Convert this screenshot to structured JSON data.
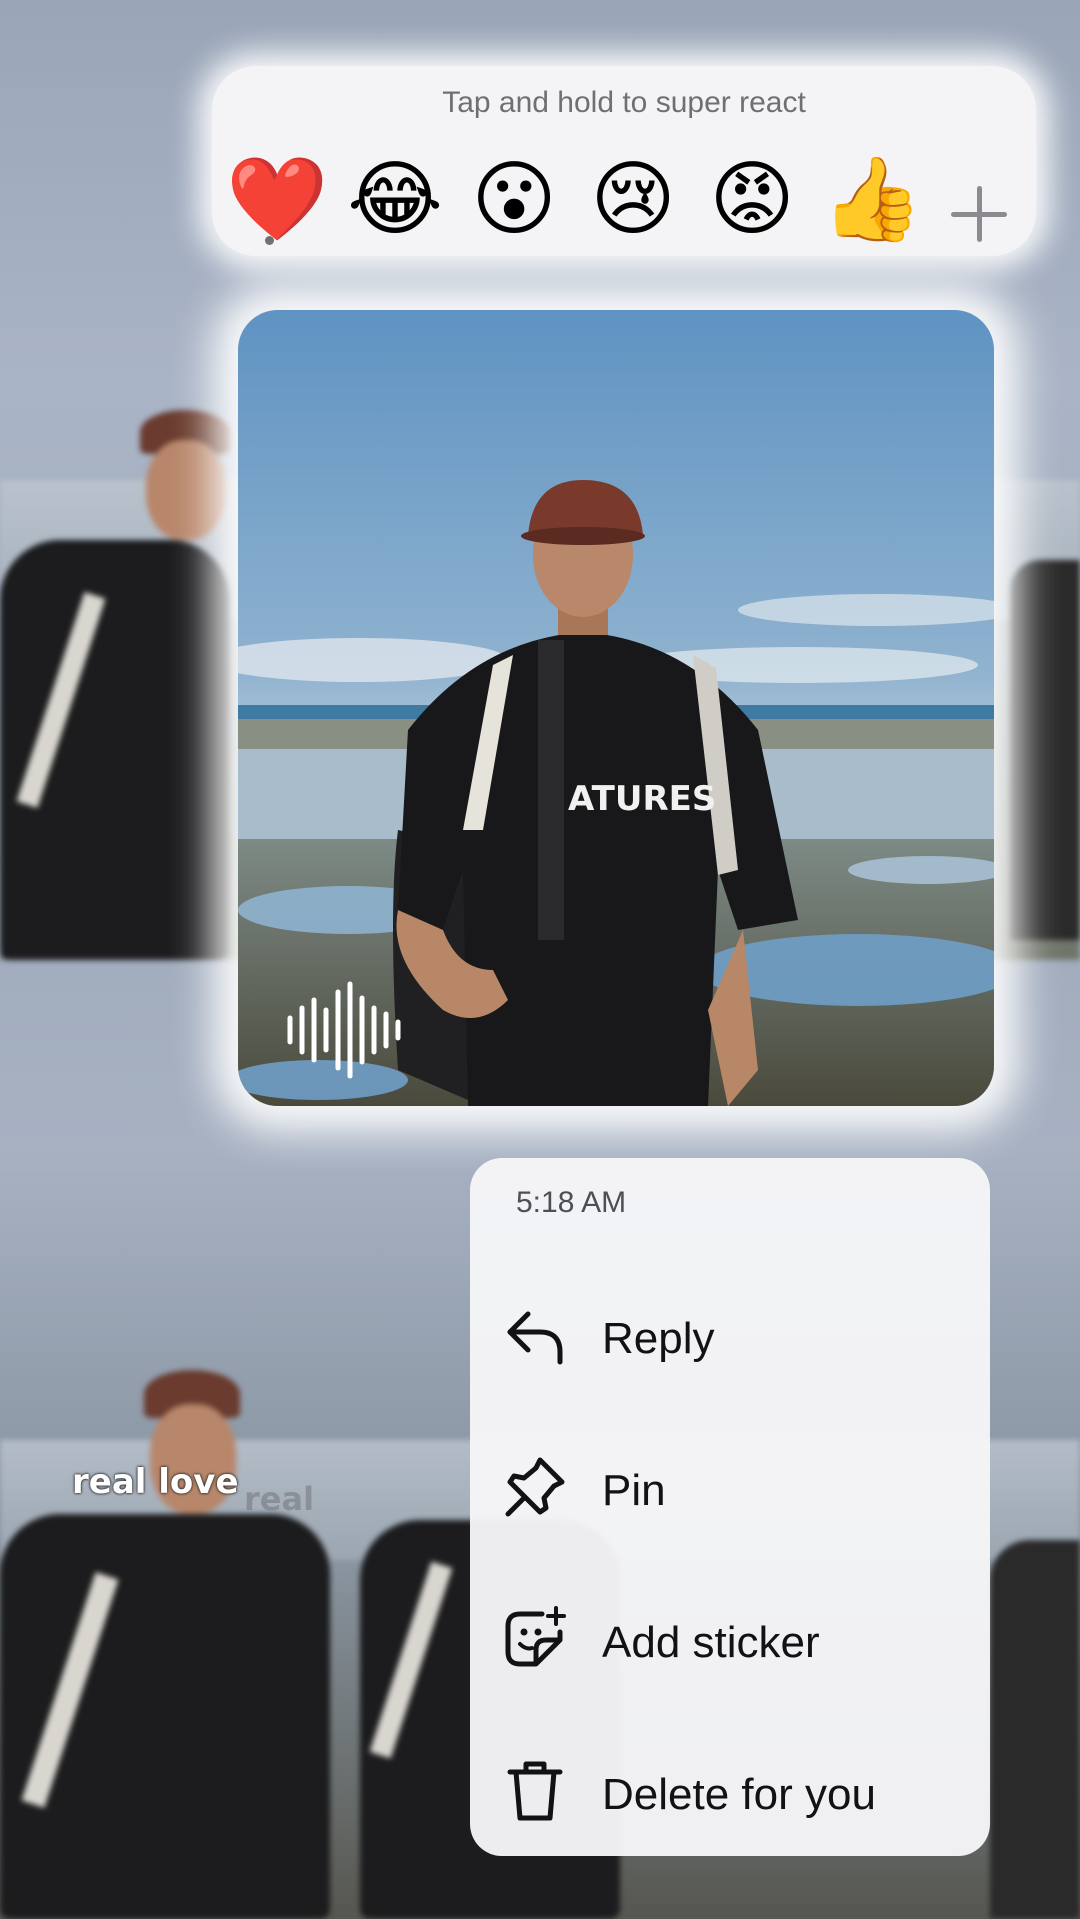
{
  "reaction_bar": {
    "hint": "Tap and hold to super react",
    "emojis": [
      {
        "name": "red-heart-emoji",
        "glyph": "❤️"
      },
      {
        "name": "tears-of-joy-emoji",
        "glyph": "😂"
      },
      {
        "name": "surprised-emoji",
        "glyph": "😮"
      },
      {
        "name": "crying-emoji",
        "glyph": "😢"
      },
      {
        "name": "angry-emoji",
        "glyph": "😡"
      },
      {
        "name": "thumbs-up-emoji",
        "glyph": "👍"
      }
    ],
    "more_icon": "plus-icon"
  },
  "message": {
    "type": "photo",
    "audio_icon": "sound-wave-icon"
  },
  "context_menu": {
    "time": "5:18 AM",
    "items": [
      {
        "label": "Reply",
        "icon": "reply-icon"
      },
      {
        "label": "Pin",
        "icon": "pin-icon"
      },
      {
        "label": "Add sticker",
        "icon": "add-sticker-icon"
      },
      {
        "label": "Delete for you",
        "icon": "trash-icon"
      }
    ]
  },
  "background": {
    "story_text": "real love",
    "story_text_ghost": "real"
  },
  "colors": {
    "menu_bg": "#f6f6f8",
    "text_primary": "#111214",
    "text_secondary": "#6f7075"
  }
}
